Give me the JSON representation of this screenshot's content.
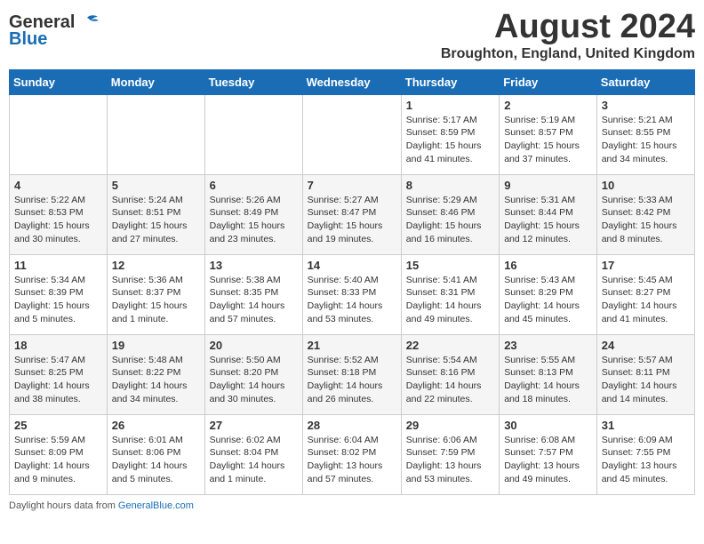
{
  "header": {
    "logo_line1": "General",
    "logo_line2": "Blue",
    "month_title": "August 2024",
    "location": "Broughton, England, United Kingdom"
  },
  "days_of_week": [
    "Sunday",
    "Monday",
    "Tuesday",
    "Wednesday",
    "Thursday",
    "Friday",
    "Saturday"
  ],
  "weeks": [
    [
      {
        "day": "",
        "info": ""
      },
      {
        "day": "",
        "info": ""
      },
      {
        "day": "",
        "info": ""
      },
      {
        "day": "",
        "info": ""
      },
      {
        "day": "1",
        "info": "Sunrise: 5:17 AM\nSunset: 8:59 PM\nDaylight: 15 hours and 41 minutes."
      },
      {
        "day": "2",
        "info": "Sunrise: 5:19 AM\nSunset: 8:57 PM\nDaylight: 15 hours and 37 minutes."
      },
      {
        "day": "3",
        "info": "Sunrise: 5:21 AM\nSunset: 8:55 PM\nDaylight: 15 hours and 34 minutes."
      }
    ],
    [
      {
        "day": "4",
        "info": "Sunrise: 5:22 AM\nSunset: 8:53 PM\nDaylight: 15 hours and 30 minutes."
      },
      {
        "day": "5",
        "info": "Sunrise: 5:24 AM\nSunset: 8:51 PM\nDaylight: 15 hours and 27 minutes."
      },
      {
        "day": "6",
        "info": "Sunrise: 5:26 AM\nSunset: 8:49 PM\nDaylight: 15 hours and 23 minutes."
      },
      {
        "day": "7",
        "info": "Sunrise: 5:27 AM\nSunset: 8:47 PM\nDaylight: 15 hours and 19 minutes."
      },
      {
        "day": "8",
        "info": "Sunrise: 5:29 AM\nSunset: 8:46 PM\nDaylight: 15 hours and 16 minutes."
      },
      {
        "day": "9",
        "info": "Sunrise: 5:31 AM\nSunset: 8:44 PM\nDaylight: 15 hours and 12 minutes."
      },
      {
        "day": "10",
        "info": "Sunrise: 5:33 AM\nSunset: 8:42 PM\nDaylight: 15 hours and 8 minutes."
      }
    ],
    [
      {
        "day": "11",
        "info": "Sunrise: 5:34 AM\nSunset: 8:39 PM\nDaylight: 15 hours and 5 minutes."
      },
      {
        "day": "12",
        "info": "Sunrise: 5:36 AM\nSunset: 8:37 PM\nDaylight: 15 hours and 1 minute."
      },
      {
        "day": "13",
        "info": "Sunrise: 5:38 AM\nSunset: 8:35 PM\nDaylight: 14 hours and 57 minutes."
      },
      {
        "day": "14",
        "info": "Sunrise: 5:40 AM\nSunset: 8:33 PM\nDaylight: 14 hours and 53 minutes."
      },
      {
        "day": "15",
        "info": "Sunrise: 5:41 AM\nSunset: 8:31 PM\nDaylight: 14 hours and 49 minutes."
      },
      {
        "day": "16",
        "info": "Sunrise: 5:43 AM\nSunset: 8:29 PM\nDaylight: 14 hours and 45 minutes."
      },
      {
        "day": "17",
        "info": "Sunrise: 5:45 AM\nSunset: 8:27 PM\nDaylight: 14 hours and 41 minutes."
      }
    ],
    [
      {
        "day": "18",
        "info": "Sunrise: 5:47 AM\nSunset: 8:25 PM\nDaylight: 14 hours and 38 minutes."
      },
      {
        "day": "19",
        "info": "Sunrise: 5:48 AM\nSunset: 8:22 PM\nDaylight: 14 hours and 34 minutes."
      },
      {
        "day": "20",
        "info": "Sunrise: 5:50 AM\nSunset: 8:20 PM\nDaylight: 14 hours and 30 minutes."
      },
      {
        "day": "21",
        "info": "Sunrise: 5:52 AM\nSunset: 8:18 PM\nDaylight: 14 hours and 26 minutes."
      },
      {
        "day": "22",
        "info": "Sunrise: 5:54 AM\nSunset: 8:16 PM\nDaylight: 14 hours and 22 minutes."
      },
      {
        "day": "23",
        "info": "Sunrise: 5:55 AM\nSunset: 8:13 PM\nDaylight: 14 hours and 18 minutes."
      },
      {
        "day": "24",
        "info": "Sunrise: 5:57 AM\nSunset: 8:11 PM\nDaylight: 14 hours and 14 minutes."
      }
    ],
    [
      {
        "day": "25",
        "info": "Sunrise: 5:59 AM\nSunset: 8:09 PM\nDaylight: 14 hours and 9 minutes."
      },
      {
        "day": "26",
        "info": "Sunrise: 6:01 AM\nSunset: 8:06 PM\nDaylight: 14 hours and 5 minutes."
      },
      {
        "day": "27",
        "info": "Sunrise: 6:02 AM\nSunset: 8:04 PM\nDaylight: 14 hours and 1 minute."
      },
      {
        "day": "28",
        "info": "Sunrise: 6:04 AM\nSunset: 8:02 PM\nDaylight: 13 hours and 57 minutes."
      },
      {
        "day": "29",
        "info": "Sunrise: 6:06 AM\nSunset: 7:59 PM\nDaylight: 13 hours and 53 minutes."
      },
      {
        "day": "30",
        "info": "Sunrise: 6:08 AM\nSunset: 7:57 PM\nDaylight: 13 hours and 49 minutes."
      },
      {
        "day": "31",
        "info": "Sunrise: 6:09 AM\nSunset: 7:55 PM\nDaylight: 13 hours and 45 minutes."
      }
    ]
  ],
  "footer": {
    "daylight_label": "Daylight hours"
  }
}
